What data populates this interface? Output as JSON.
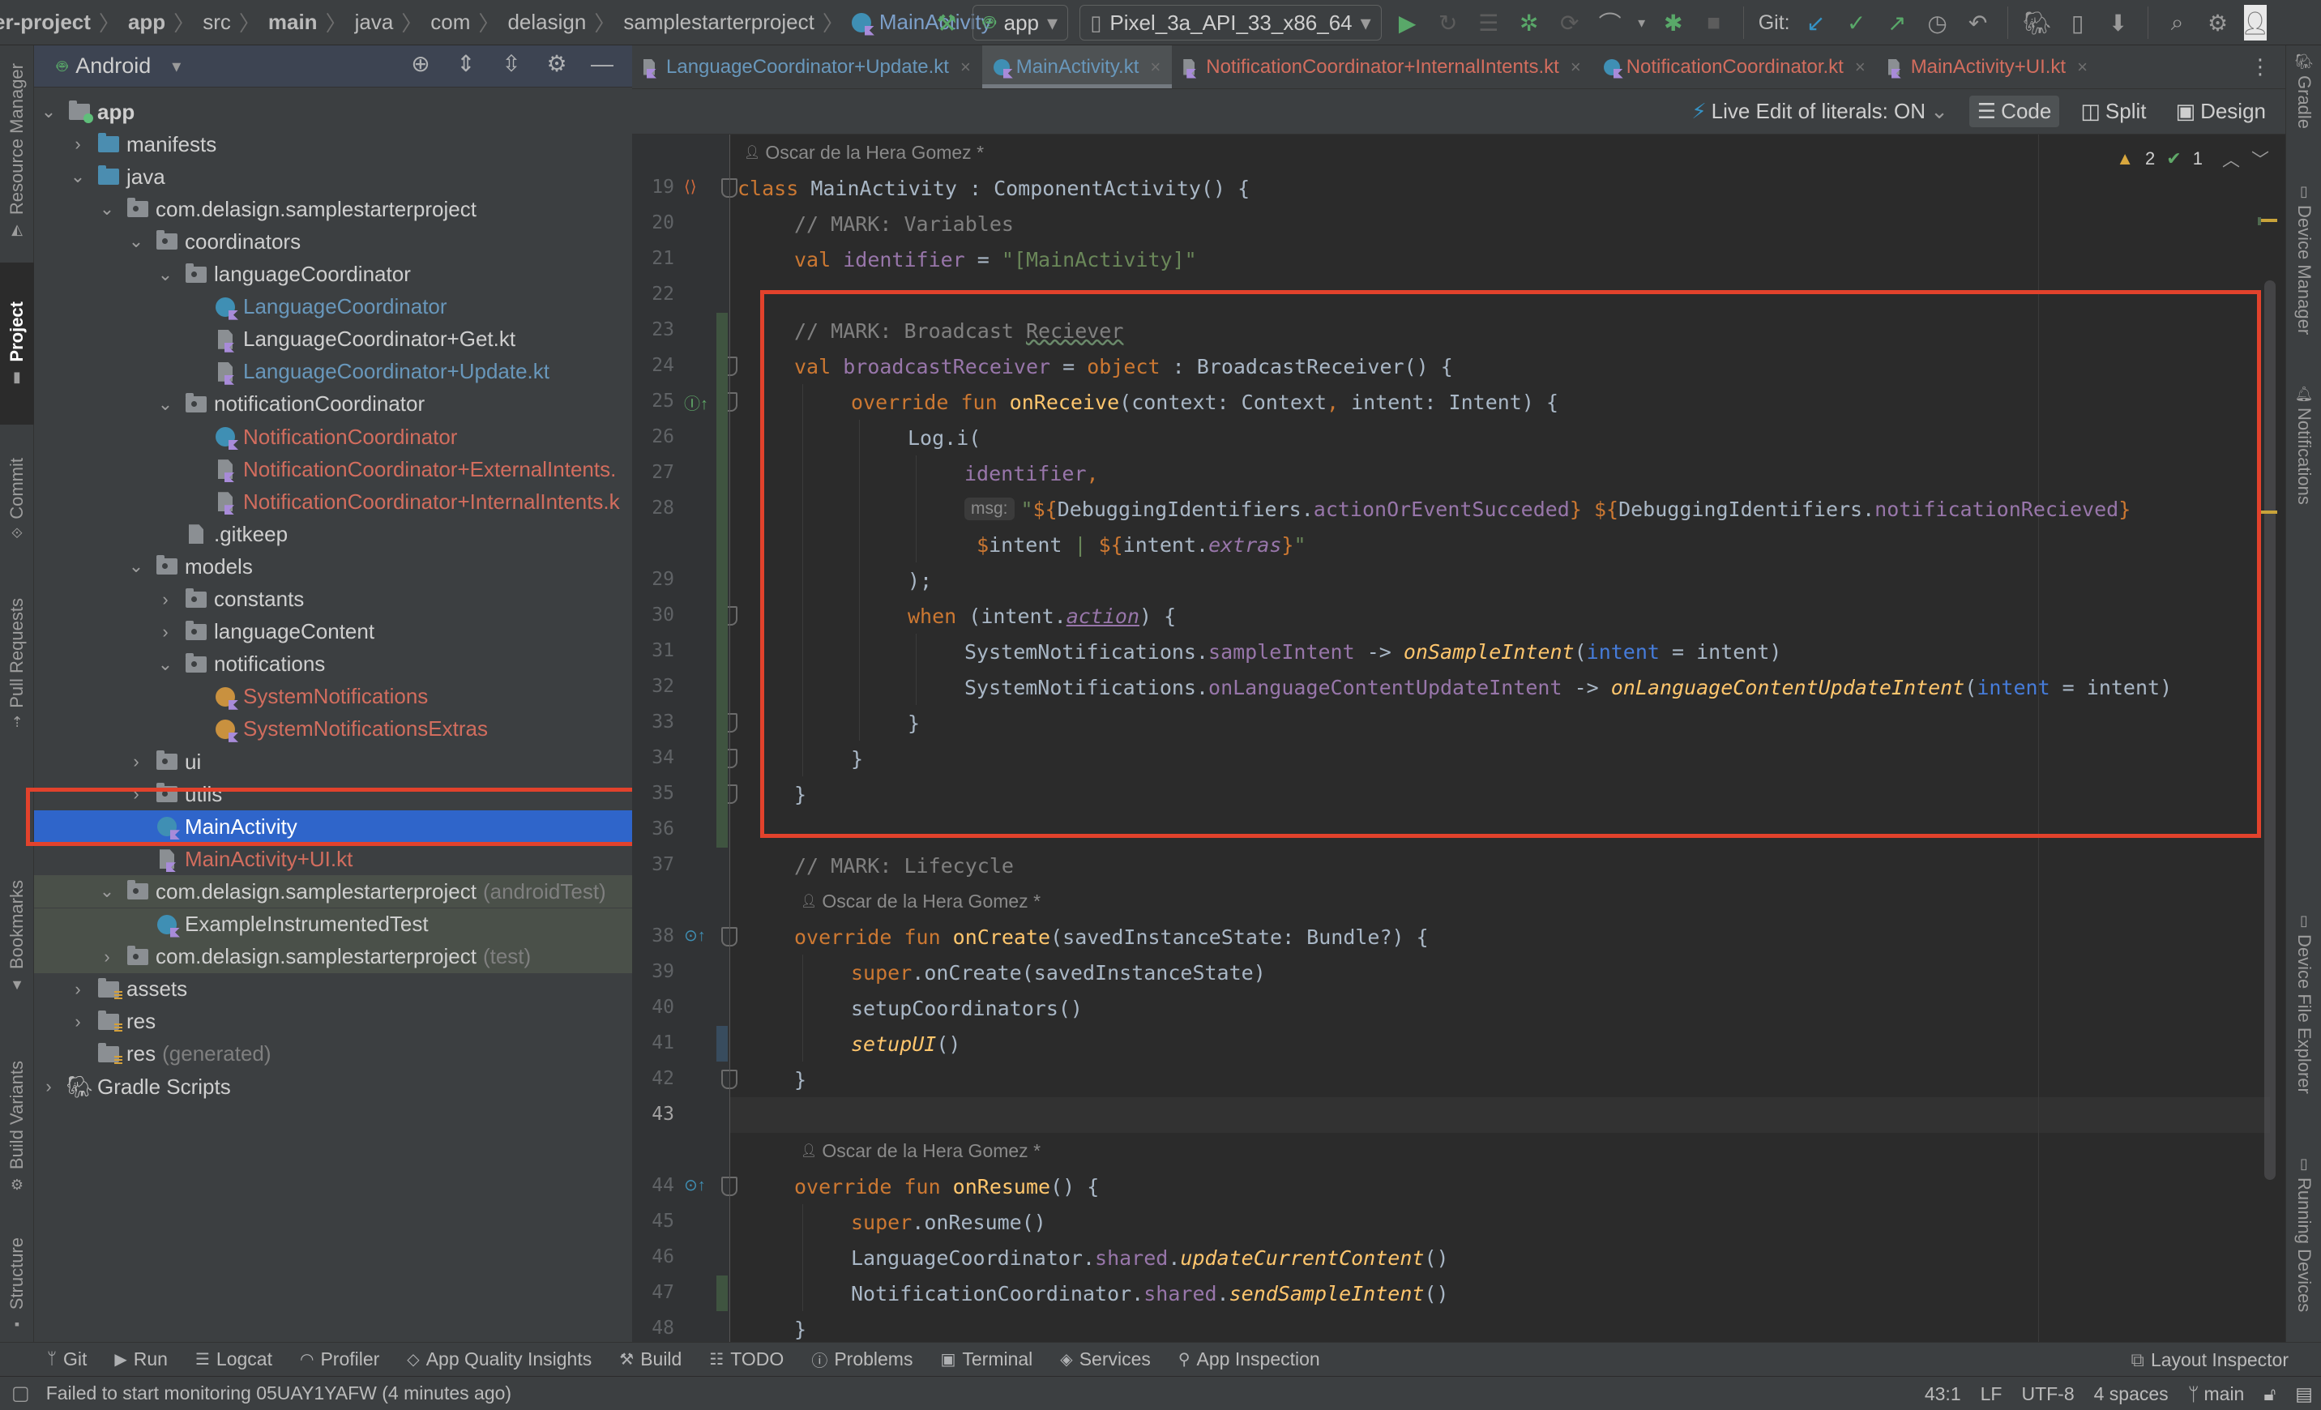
{
  "navbar": {
    "breadcrumbs": [
      {
        "label": "er-project",
        "bold": true
      },
      {
        "label": "app",
        "bold": true
      },
      {
        "label": "src",
        "bold": false
      },
      {
        "label": "main",
        "bold": true
      },
      {
        "label": "java",
        "bold": false
      },
      {
        "label": "com",
        "bold": false
      },
      {
        "label": "delasign",
        "bold": false
      },
      {
        "label": "samplestarterproject",
        "bold": false
      }
    ],
    "current_file": "MainActivity",
    "run_config": "app",
    "device": "Pixel_3a_API_33_x86_64",
    "git_label": "Git:"
  },
  "left_strip": {
    "tabs": [
      "Resource Manager",
      "Project",
      "Commit",
      "Pull Requests",
      "Bookmarks",
      "Build Variants",
      "Structure"
    ],
    "active": "Project"
  },
  "right_strip": {
    "tabs": [
      "Gradle",
      "Device Manager",
      "Notifications",
      "Device File Explorer",
      "Running Devices"
    ]
  },
  "project": {
    "view_mode": "Android",
    "tree": [
      {
        "label": "app",
        "depth": 0,
        "chevron": "down",
        "icon": "app-module",
        "color": "default",
        "bold": true
      },
      {
        "label": "manifests",
        "depth": 1,
        "chevron": "right",
        "icon": "source-folder",
        "color": "default"
      },
      {
        "label": "java",
        "depth": 1,
        "chevron": "down",
        "icon": "source-folder",
        "color": "default"
      },
      {
        "label": "com.delasign.samplestarterproject",
        "depth": 2,
        "chevron": "down",
        "icon": "package",
        "color": "default"
      },
      {
        "label": "coordinators",
        "depth": 3,
        "chevron": "down",
        "icon": "package",
        "color": "default"
      },
      {
        "label": "languageCoordinator",
        "depth": 4,
        "chevron": "down",
        "icon": "package",
        "color": "default"
      },
      {
        "label": "LanguageCoordinator",
        "depth": 5,
        "chevron": "",
        "icon": "kotlin-class",
        "color": "blue"
      },
      {
        "label": "LanguageCoordinator+Get.kt",
        "depth": 5,
        "chevron": "",
        "icon": "kotlin-file",
        "color": "default"
      },
      {
        "label": "LanguageCoordinator+Update.kt",
        "depth": 5,
        "chevron": "",
        "icon": "kotlin-file",
        "color": "blue"
      },
      {
        "label": "notificationCoordinator",
        "depth": 4,
        "chevron": "down",
        "icon": "package",
        "color": "default"
      },
      {
        "label": "NotificationCoordinator",
        "depth": 5,
        "chevron": "",
        "icon": "kotlin-class",
        "color": "red"
      },
      {
        "label": "NotificationCoordinator+ExternalIntents.",
        "depth": 5,
        "chevron": "",
        "icon": "kotlin-file",
        "color": "red"
      },
      {
        "label": "NotificationCoordinator+InternalIntents.k",
        "depth": 5,
        "chevron": "",
        "icon": "kotlin-file",
        "color": "red"
      },
      {
        "label": ".gitkeep",
        "depth": 4,
        "chevron": "",
        "icon": "text-file",
        "color": "default"
      },
      {
        "label": "models",
        "depth": 3,
        "chevron": "down",
        "icon": "package",
        "color": "default"
      },
      {
        "label": "constants",
        "depth": 4,
        "chevron": "right",
        "icon": "package",
        "color": "default"
      },
      {
        "label": "languageContent",
        "depth": 4,
        "chevron": "right",
        "icon": "package",
        "color": "default"
      },
      {
        "label": "notifications",
        "depth": 4,
        "chevron": "down",
        "icon": "package",
        "color": "default"
      },
      {
        "label": "SystemNotifications",
        "depth": 5,
        "chevron": "",
        "icon": "kotlin-object",
        "color": "red"
      },
      {
        "label": "SystemNotificationsExtras",
        "depth": 5,
        "chevron": "",
        "icon": "kotlin-object",
        "color": "red"
      },
      {
        "label": "ui",
        "depth": 3,
        "chevron": "right",
        "icon": "package",
        "color": "default"
      },
      {
        "label": "utils",
        "depth": 3,
        "chevron": "right",
        "icon": "package",
        "color": "default"
      },
      {
        "label": "MainActivity",
        "depth": 3,
        "chevron": "",
        "icon": "kotlin-class",
        "color": "default",
        "selected": true
      },
      {
        "label": "MainActivity+UI.kt",
        "depth": 3,
        "chevron": "",
        "icon": "kotlin-file",
        "color": "red"
      },
      {
        "label": "com.delasign.samplestarterproject",
        "suffix": "(androidTest)",
        "depth": 2,
        "chevron": "down",
        "icon": "package",
        "color": "default",
        "test": true
      },
      {
        "label": "ExampleInstrumentedTest",
        "depth": 3,
        "chevron": "",
        "icon": "kotlin-class",
        "color": "default",
        "test": true
      },
      {
        "label": "com.delasign.samplestarterproject",
        "suffix": "(test)",
        "depth": 2,
        "chevron": "right",
        "icon": "package",
        "color": "default",
        "test": true
      },
      {
        "label": "assets",
        "depth": 1,
        "chevron": "right",
        "icon": "res-folder",
        "color": "default"
      },
      {
        "label": "res",
        "depth": 1,
        "chevron": "right",
        "icon": "res-folder",
        "color": "default"
      },
      {
        "label": "res",
        "suffix": "(generated)",
        "depth": 1,
        "chevron": "",
        "icon": "res-folder",
        "color": "default"
      },
      {
        "label": "Gradle Scripts",
        "depth": 0,
        "chevron": "right",
        "icon": "gradle",
        "color": "default"
      }
    ]
  },
  "editor": {
    "tabs": [
      {
        "label": "LanguageCoordinator+Update.kt",
        "color": "blue",
        "icon": "kotlin-file",
        "active": false
      },
      {
        "label": "MainActivity.kt",
        "color": "blue",
        "icon": "kotlin-class",
        "active": true
      },
      {
        "label": "NotificationCoordinator+InternalIntents.kt",
        "color": "red",
        "icon": "kotlin-file",
        "active": false
      },
      {
        "label": "NotificationCoordinator.kt",
        "color": "red",
        "icon": "kotlin-class",
        "active": false
      },
      {
        "label": "MainActivity+UI.kt",
        "color": "red",
        "icon": "kotlin-file",
        "active": false
      }
    ],
    "toolbar": {
      "live_edit": "Live Edit of literals: ON",
      "code": "Code",
      "split": "Split",
      "design": "Design",
      "active_view": "Code"
    },
    "inspections": {
      "warnings": "2",
      "weak_warnings": "1"
    },
    "author": "Oscar de la Hera Gomez *",
    "lines": [
      {
        "type": "author"
      },
      {
        "num": "19",
        "tokens": [
          [
            "kw",
            "class "
          ],
          [
            "plain",
            "MainActivity : ComponentActivity() {"
          ]
        ]
      },
      {
        "num": "20",
        "indent": 1,
        "tokens": [
          [
            "cm",
            "// MARK: Variables"
          ]
        ]
      },
      {
        "num": "21",
        "indent": 1,
        "tokens": [
          [
            "kw",
            "val "
          ],
          [
            "prop",
            "identifier"
          ],
          [
            "plain",
            " = "
          ],
          [
            "str",
            "\"[MainActivity]\""
          ]
        ]
      },
      {
        "num": "22",
        "tokens": []
      },
      {
        "num": "23",
        "indent": 1,
        "tokens": [
          [
            "cm",
            "// MARK: Broadcast "
          ],
          [
            "cm-wavy",
            "Reciever"
          ]
        ]
      },
      {
        "num": "24",
        "indent": 1,
        "tokens": [
          [
            "kw",
            "val "
          ],
          [
            "prop",
            "broadcastReceiver"
          ],
          [
            "plain",
            " = "
          ],
          [
            "kw",
            "object"
          ],
          [
            "plain",
            " : BroadcastReceiver() {"
          ]
        ]
      },
      {
        "num": "25",
        "indent": 2,
        "tokens": [
          [
            "kw",
            "override fun "
          ],
          [
            "fn",
            "onReceive"
          ],
          [
            "plain",
            "(context: Context"
          ],
          [
            "kw",
            ", "
          ],
          [
            "plain",
            "intent: Intent) {"
          ]
        ]
      },
      {
        "num": "26",
        "indent": 3,
        "tokens": [
          [
            "plain",
            "Log.i("
          ]
        ]
      },
      {
        "num": "27",
        "indent": 4,
        "tokens": [
          [
            "prop",
            "identifier"
          ],
          [
            "kw",
            ","
          ]
        ]
      },
      {
        "num": "28",
        "indent": 4,
        "tokens": [
          [
            "hint",
            "msg:"
          ],
          [
            "str",
            "\""
          ],
          [
            "tmpl",
            "${"
          ],
          [
            "plain",
            "DebuggingIdentifiers."
          ],
          [
            "prop",
            "actionOrEventSucceded"
          ],
          [
            "tmpl",
            "}"
          ],
          [
            "str",
            " "
          ],
          [
            "tmpl",
            "${"
          ],
          [
            "plain",
            "DebuggingIdentifiers."
          ],
          [
            "prop",
            "notificationRecieved"
          ],
          [
            "tmpl",
            "}"
          ]
        ]
      },
      {
        "num": "",
        "indent": 4,
        "tokens": [
          [
            "str",
            " "
          ],
          [
            "tmpl",
            "$"
          ],
          [
            "plain",
            "intent"
          ],
          [
            "str",
            " | "
          ],
          [
            "tmpl",
            "${"
          ],
          [
            "plain",
            "intent."
          ],
          [
            "prop-it",
            "extras"
          ],
          [
            "tmpl",
            "}"
          ],
          [
            "str",
            "\""
          ]
        ]
      },
      {
        "num": "29",
        "indent": 3,
        "tokens": [
          [
            "plain",
            ");"
          ]
        ]
      },
      {
        "num": "30",
        "indent": 3,
        "tokens": [
          [
            "kw",
            "when "
          ],
          [
            "plain",
            "(intent."
          ],
          [
            "prop-ul",
            "action"
          ],
          [
            "plain",
            ") {"
          ]
        ]
      },
      {
        "num": "31",
        "indent": 4,
        "tokens": [
          [
            "plain",
            "SystemNotifications."
          ],
          [
            "prop",
            "sampleIntent"
          ],
          [
            "plain",
            " -> "
          ],
          [
            "fn-it",
            "onSampleIntent"
          ],
          [
            "plain",
            "("
          ],
          [
            "named",
            "intent"
          ],
          [
            "plain",
            " = intent)"
          ]
        ]
      },
      {
        "num": "32",
        "indent": 4,
        "tokens": [
          [
            "plain",
            "SystemNotifications."
          ],
          [
            "prop",
            "onLanguageContentUpdateIntent"
          ],
          [
            "plain",
            " -> "
          ],
          [
            "fn-it",
            "onLanguageContentUpdateIntent"
          ],
          [
            "plain",
            "("
          ],
          [
            "named",
            "intent"
          ],
          [
            "plain",
            " = intent)"
          ]
        ]
      },
      {
        "num": "33",
        "indent": 3,
        "tokens": [
          [
            "plain",
            "}"
          ]
        ]
      },
      {
        "num": "34",
        "indent": 2,
        "tokens": [
          [
            "plain",
            "}"
          ]
        ]
      },
      {
        "num": "35",
        "indent": 1,
        "tokens": [
          [
            "plain",
            "}"
          ]
        ]
      },
      {
        "num": "36",
        "tokens": []
      },
      {
        "num": "37",
        "indent": 1,
        "tokens": [
          [
            "cm",
            "// MARK: Lifecycle"
          ]
        ]
      },
      {
        "type": "author"
      },
      {
        "num": "38",
        "indent": 1,
        "tokens": [
          [
            "kw",
            "override fun "
          ],
          [
            "fn",
            "onCreate"
          ],
          [
            "plain",
            "(savedInstanceState: Bundle?) {"
          ]
        ]
      },
      {
        "num": "39",
        "indent": 2,
        "tokens": [
          [
            "kw",
            "super"
          ],
          [
            "plain",
            ".onCreate(savedInstanceState)"
          ]
        ]
      },
      {
        "num": "40",
        "indent": 2,
        "tokens": [
          [
            "plain",
            "setupCoordinators()"
          ]
        ]
      },
      {
        "num": "41",
        "indent": 2,
        "tokens": [
          [
            "fn-it",
            "setupUI"
          ],
          [
            "plain",
            "()"
          ]
        ]
      },
      {
        "num": "42",
        "indent": 1,
        "tokens": [
          [
            "plain",
            "}"
          ]
        ]
      },
      {
        "num": "43",
        "tokens": [],
        "caret": true
      },
      {
        "type": "author"
      },
      {
        "num": "44",
        "indent": 1,
        "tokens": [
          [
            "kw",
            "override fun "
          ],
          [
            "fn",
            "onResume"
          ],
          [
            "plain",
            "() {"
          ]
        ]
      },
      {
        "num": "45",
        "indent": 2,
        "tokens": [
          [
            "kw",
            "super"
          ],
          [
            "plain",
            ".onResume()"
          ]
        ]
      },
      {
        "num": "46",
        "indent": 2,
        "tokens": [
          [
            "plain",
            "LanguageCoordinator."
          ],
          [
            "prop",
            "shared"
          ],
          [
            "plain",
            "."
          ],
          [
            "fn-it",
            "updateCurrentContent"
          ],
          [
            "plain",
            "()"
          ]
        ]
      },
      {
        "num": "47",
        "indent": 2,
        "tokens": [
          [
            "plain",
            "NotificationCoordinator."
          ],
          [
            "prop",
            "shared"
          ],
          [
            "plain",
            "."
          ],
          [
            "fn-it",
            "sendSampleIntent"
          ],
          [
            "plain",
            "()"
          ]
        ]
      },
      {
        "num": "48",
        "indent": 1,
        "tokens": [
          [
            "plain",
            "}"
          ]
        ]
      }
    ]
  },
  "bottom_tools": {
    "left": [
      {
        "label": "Git",
        "icon": "git-branch-icon"
      },
      {
        "label": "Run",
        "icon": "play-icon"
      },
      {
        "label": "Logcat",
        "icon": "logcat-icon"
      },
      {
        "label": "Profiler",
        "icon": "gauge-icon"
      },
      {
        "label": "App Quality Insights",
        "icon": "diamond-icon"
      },
      {
        "label": "Build",
        "icon": "hammer-icon"
      },
      {
        "label": "TODO",
        "icon": "list-icon"
      },
      {
        "label": "Problems",
        "icon": "problems-icon"
      },
      {
        "label": "Terminal",
        "icon": "terminal-icon"
      },
      {
        "label": "Services",
        "icon": "services-icon"
      },
      {
        "label": "App Inspection",
        "icon": "inspection-icon"
      }
    ],
    "right": {
      "label": "Layout Inspector"
    }
  },
  "status": {
    "message": "Failed to start monitoring 05UAY1YAFW (4 minutes ago)",
    "position": "43:1",
    "line_ending": "LF",
    "encoding": "UTF-8",
    "indent": "4 spaces",
    "branch": "main"
  },
  "colors": {
    "highlight": "#e2422c",
    "selection": "#2f65ca"
  }
}
